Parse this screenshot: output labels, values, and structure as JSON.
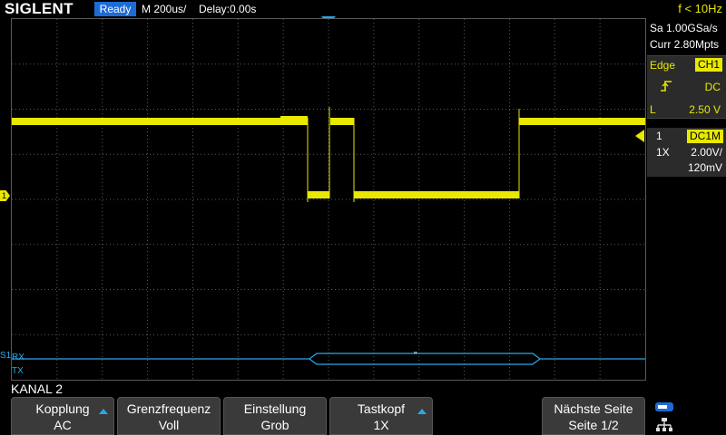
{
  "header": {
    "brand": "SIGLENT",
    "status": "Ready",
    "timebase": "M 200us/",
    "delay": "Delay:0.00s",
    "frequency": "f < 10Hz"
  },
  "acquisition": {
    "sample_rate": "Sa 1.00GSa/s",
    "memory_depth": "Curr 2.80Mpts"
  },
  "trigger": {
    "type": "Edge",
    "source": "CH1",
    "slope_icon": "rising-edge-icon",
    "coupling": "DC",
    "level_label": "L",
    "level": "2.50 V"
  },
  "channel": {
    "number": "1",
    "coupling": "DC1M",
    "probe": "1X",
    "scale": "2.00V/",
    "offset": "120mV",
    "marker": "1"
  },
  "decode": {
    "marker": "S1",
    "rx_label": "RX",
    "tx_label": "TX",
    "frame_text": "\"",
    "color": "#29a8e8"
  },
  "colors": {
    "trace": "#e8e800",
    "accent": "#29a8e8",
    "grid": "#5a5a5a"
  },
  "menu": {
    "title": "KANAL 2",
    "keys": [
      {
        "label": "Kopplung",
        "value": "AC",
        "arrow": true
      },
      {
        "label": "Grenzfrequenz",
        "value": "Voll",
        "arrow": false
      },
      {
        "label": "Einstellung",
        "value": "Grob",
        "arrow": false
      },
      {
        "label": "Tastkopf",
        "value": "1X",
        "arrow": true
      },
      {
        "label": "Nächste Seite",
        "value": "Seite 1/2",
        "arrow": false
      }
    ],
    "icons": [
      "usb-icon",
      "network-icon"
    ]
  }
}
